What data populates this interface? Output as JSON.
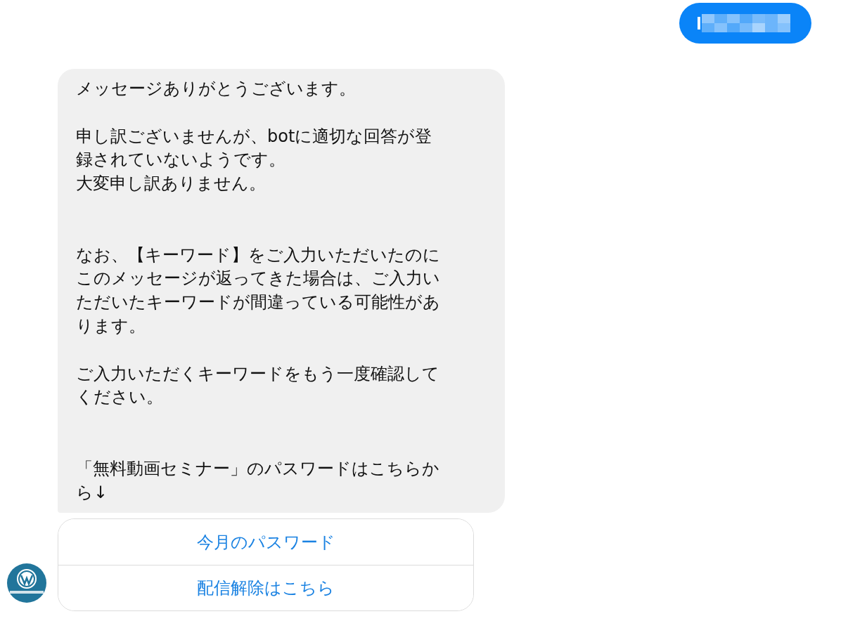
{
  "user_message": {
    "redacted": true
  },
  "bot_message": {
    "lines": [
      {
        "kind": "line",
        "text": "メッセージありがとうございます。"
      },
      {
        "kind": "gap"
      },
      {
        "kind": "line",
        "text": "申し訳ございませんが、botに適切な回答が登"
      },
      {
        "kind": "line",
        "text": "録されていないようです。"
      },
      {
        "kind": "line",
        "text": "大変申し訳ありません。"
      },
      {
        "kind": "gap"
      },
      {
        "kind": "gap"
      },
      {
        "kind": "line",
        "text": "なお、【キーワード】をご入力いただいたのに"
      },
      {
        "kind": "line",
        "text": "このメッセージが返ってきた場合は、ご入力い"
      },
      {
        "kind": "line",
        "text": "ただいたキーワードが間違っている可能性があ"
      },
      {
        "kind": "line",
        "text": "ります。"
      },
      {
        "kind": "gap"
      },
      {
        "kind": "line",
        "text": "ご入力いただくキーワードをもう一度確認して"
      },
      {
        "kind": "line",
        "text": "ください。"
      },
      {
        "kind": "gap"
      },
      {
        "kind": "gap"
      },
      {
        "kind": "line",
        "text": "「無料動画セミナー」のパスワードはこちらか"
      },
      {
        "kind": "line",
        "text": "ら↓"
      }
    ]
  },
  "quick_buttons": [
    {
      "label": "今月のパスワード"
    },
    {
      "label": "配信解除はこちら"
    }
  ]
}
